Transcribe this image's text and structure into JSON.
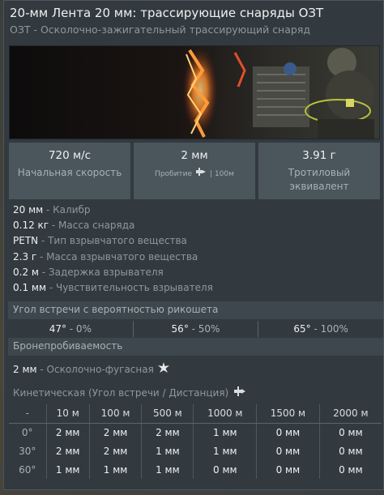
{
  "title": "20-мм Лента 20 мм: трассирующие снаряды ОЗТ",
  "subtitle": "ОЗТ - Осколочно-зажигательный трассирующий снаряд",
  "stats": [
    {
      "value": "720 м/с",
      "label": "Начальная скорость"
    },
    {
      "value": "2 мм",
      "label": "Пробитие",
      "suffix": "| 100м",
      "icon": "penetration-icon"
    },
    {
      "value": "3.91 г",
      "label": "Тротиловый эквивалент"
    }
  ],
  "specs": [
    {
      "value": "20 мм",
      "label": " - Калибр"
    },
    {
      "value": "0.12 кг",
      "label": " - Масса снаряда"
    },
    {
      "value": "PETN",
      "label": " - Тип взрывчатого вещества"
    },
    {
      "value": "2.3 г",
      "label": " - Масса взрывчатого вещества"
    },
    {
      "value": "0.2 м",
      "label": " - Задержка взрывателя"
    },
    {
      "value": "0.1 мм",
      "label": " - Чувствительность взрывателя"
    }
  ],
  "ricochet": {
    "header": "Угол встречи с вероятностью рикошета",
    "items": [
      {
        "angle": "47°",
        "prob": " - 0%"
      },
      {
        "angle": "56°",
        "prob": " - 50%"
      },
      {
        "angle": "65°",
        "prob": " - 100%"
      }
    ]
  },
  "penetration": {
    "header": "Бронепробиваемость",
    "he_value": "2 мм",
    "he_label": " - Осколочно-фугасная",
    "kinetic_label": "Кинетическая (Угол встречи / Дистанция)"
  },
  "table": {
    "columns": [
      "-",
      "10 м",
      "100 м",
      "500 м",
      "1000 м",
      "1500 м",
      "2000 м"
    ],
    "rows": [
      {
        "angle": "0°",
        "cells": [
          "2 мм",
          "2 мм",
          "2 мм",
          "1 мм",
          "0 мм",
          "0 мм"
        ]
      },
      {
        "angle": "30°",
        "cells": [
          "2 мм",
          "2 мм",
          "1 мм",
          "1 мм",
          "0 мм",
          "0 мм"
        ]
      },
      {
        "angle": "60°",
        "cells": [
          "1 мм",
          "1 мм",
          "1 мм",
          "0 мм",
          "0 мм",
          "0 мм"
        ]
      }
    ]
  },
  "colors": {
    "panel": "#323a3f",
    "stat_bg": "#4a555c",
    "section_bg": "#3d474d",
    "text_bright": "#eef1f3",
    "text_muted": "#8e989e"
  }
}
